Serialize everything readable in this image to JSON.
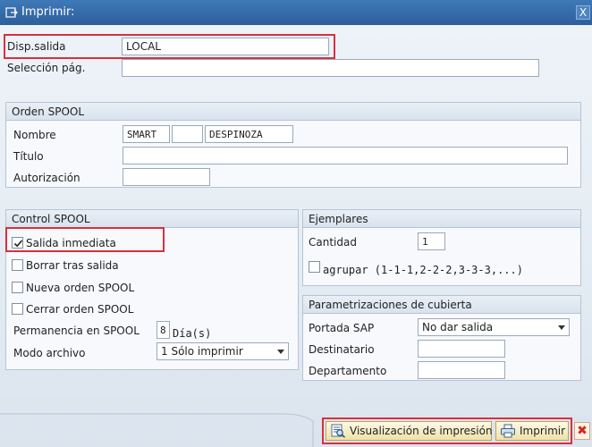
{
  "window": {
    "title": "Imprimir:",
    "close_label": "X"
  },
  "output": {
    "device_label": "Disp.salida",
    "device_value": "LOCAL",
    "page_sel_label": "Selección pág.",
    "page_sel_value": ""
  },
  "spool_order": {
    "section_title": "Orden SPOOL",
    "name_label": "Nombre",
    "name_part1": "SMART",
    "name_part2": "",
    "name_part3": "DESPINOZA",
    "title_label": "Título",
    "title_value": "",
    "auth_label": "Autorización",
    "auth_value": ""
  },
  "spool_control": {
    "section_title": "Control SPOOL",
    "options": [
      {
        "label": "Salida inmediata",
        "checked": true
      },
      {
        "label": "Borrar tras salida",
        "checked": false
      },
      {
        "label": "Nueva orden SPOOL",
        "checked": false
      },
      {
        "label": "Cerrar orden SPOOL",
        "checked": false
      }
    ],
    "retention_label": "Permanencia en SPOOL",
    "retention_value": "8",
    "retention_unit": "Día(s)",
    "archive_label": "Modo archivo",
    "archive_value": "1 Sólo imprimir"
  },
  "copies": {
    "section_title": "Ejemplares",
    "qty_label": "Cantidad",
    "qty_value": "1",
    "group_label": "agrupar (1-1-1,2-2-2,3-3-3,...)",
    "group_checked": false
  },
  "cover": {
    "section_title": "Parametrizaciones de cubierta",
    "sap_cover_label": "Portada SAP",
    "sap_cover_value": "No dar salida",
    "recipient_label": "Destinatario",
    "recipient_value": "",
    "department_label": "Departamento",
    "department_value": ""
  },
  "actions": {
    "preview_label": "Visualización de impresión",
    "print_label": "Imprimir",
    "cancel_label": "✖"
  },
  "colors": {
    "title_bar": "#2f66a6",
    "highlight": "#d9303d",
    "button": "#efe1a8"
  }
}
